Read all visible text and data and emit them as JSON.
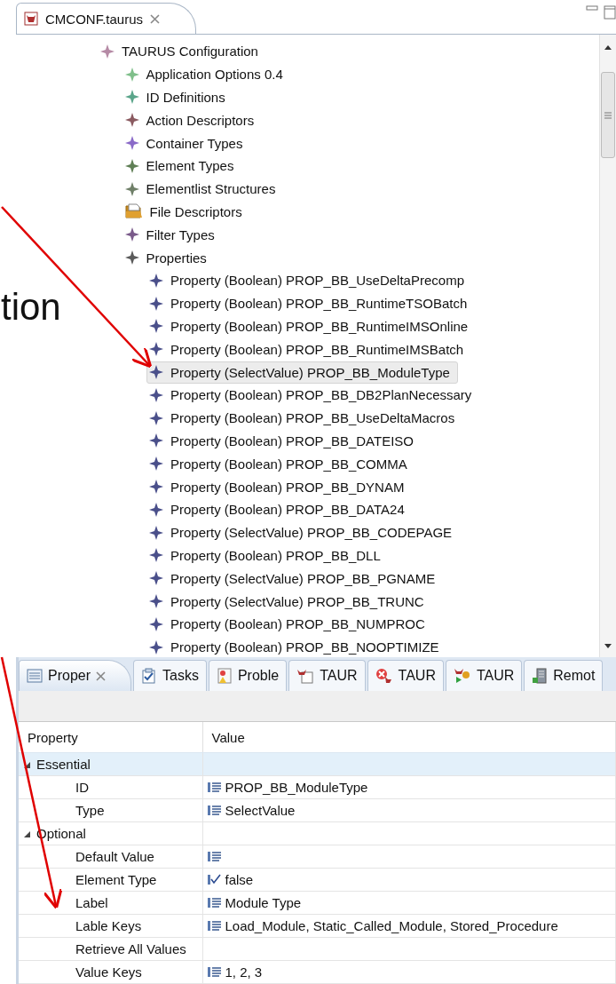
{
  "editor_tab": {
    "title": "CMCONF.taurus",
    "selected": true
  },
  "annotation": {
    "text": "tion"
  },
  "tree": [
    {
      "label": "TAURUS Configuration",
      "kind": "diamond",
      "color": "#b58aa5",
      "selected": false,
      "children": [
        {
          "label": "Application Options 0.4",
          "kind": "diamond",
          "color": "#7fbf8a",
          "selected": false
        },
        {
          "label": "ID Definitions",
          "kind": "diamond",
          "color": "#5aa58a",
          "selected": false
        },
        {
          "label": "Action Descriptors",
          "kind": "diamond",
          "color": "#8a5a60",
          "selected": false
        },
        {
          "label": "Container Types",
          "kind": "diamond",
          "color": "#8a6ac8",
          "selected": false
        },
        {
          "label": "Element Types",
          "kind": "diamond",
          "color": "#5f7f55",
          "selected": false
        },
        {
          "label": "Elementlist Structures",
          "kind": "diamond",
          "color": "#6f7f68",
          "selected": false
        },
        {
          "label": "File Descriptors",
          "kind": "folder",
          "color": "#e0a030",
          "selected": false
        },
        {
          "label": "Filter Types",
          "kind": "diamond",
          "color": "#7a5a8a",
          "selected": false
        },
        {
          "label": "Properties",
          "kind": "diamond",
          "color": "#5a5a5a",
          "selected": false,
          "children": [
            {
              "label": "Property (Boolean) PROP_BB_UseDeltaPrecomp",
              "kind": "diamond",
              "color": "#4a4f8a",
              "selected": false
            },
            {
              "label": "Property (Boolean) PROP_BB_RuntimeTSOBatch",
              "kind": "diamond",
              "color": "#4a4f8a",
              "selected": false
            },
            {
              "label": "Property (Boolean) PROP_BB_RuntimeIMSOnline",
              "kind": "diamond",
              "color": "#4a4f8a",
              "selected": false
            },
            {
              "label": "Property (Boolean) PROP_BB_RuntimeIMSBatch",
              "kind": "diamond",
              "color": "#4a4f8a",
              "selected": false
            },
            {
              "label": "Property (SelectValue) PROP_BB_ModuleType",
              "kind": "diamond",
              "color": "#4a4f8a",
              "selected": true
            },
            {
              "label": "Property (Boolean) PROP_BB_DB2PlanNecessary",
              "kind": "diamond",
              "color": "#4a4f8a",
              "selected": false
            },
            {
              "label": "Property (Boolean) PROP_BB_UseDeltaMacros",
              "kind": "diamond",
              "color": "#4a4f8a",
              "selected": false
            },
            {
              "label": "Property (Boolean) PROP_BB_DATEISO",
              "kind": "diamond",
              "color": "#4a4f8a",
              "selected": false
            },
            {
              "label": "Property (Boolean) PROP_BB_COMMA",
              "kind": "diamond",
              "color": "#4a4f8a",
              "selected": false
            },
            {
              "label": "Property (Boolean) PROP_BB_DYNAM",
              "kind": "diamond",
              "color": "#4a4f8a",
              "selected": false
            },
            {
              "label": "Property (Boolean) PROP_BB_DATA24",
              "kind": "diamond",
              "color": "#4a4f8a",
              "selected": false
            },
            {
              "label": "Property (SelectValue) PROP_BB_CODEPAGE",
              "kind": "diamond",
              "color": "#4a4f8a",
              "selected": false
            },
            {
              "label": "Property (Boolean) PROP_BB_DLL",
              "kind": "diamond",
              "color": "#4a4f8a",
              "selected": false
            },
            {
              "label": "Property (SelectValue) PROP_BB_PGNAME",
              "kind": "diamond",
              "color": "#4a4f8a",
              "selected": false
            },
            {
              "label": "Property (SelectValue) PROP_BB_TRUNC",
              "kind": "diamond",
              "color": "#4a4f8a",
              "selected": false
            },
            {
              "label": "Property (Boolean) PROP_BB_NUMPROC",
              "kind": "diamond",
              "color": "#4a4f8a",
              "selected": false
            },
            {
              "label": "Property (Boolean) PROP_BB_NOOPTIMIZE",
              "kind": "diamond",
              "color": "#4a4f8a",
              "selected": false
            }
          ]
        }
      ]
    }
  ],
  "view_tabs": [
    {
      "label": "Proper",
      "kind": "list",
      "selected": true
    },
    {
      "label": "Tasks",
      "kind": "tasks",
      "selected": false
    },
    {
      "label": "Proble",
      "kind": "problems",
      "selected": false
    },
    {
      "label": "TAUR",
      "kind": "document",
      "selected": false
    },
    {
      "label": "TAUR",
      "kind": "error",
      "selected": false
    },
    {
      "label": "TAUR",
      "kind": "run",
      "selected": false
    },
    {
      "label": "Remot",
      "kind": "server",
      "selected": false
    }
  ],
  "properties": {
    "columns": [
      "Property",
      "Value"
    ],
    "categories": [
      {
        "name": "Essential",
        "expanded": true,
        "selected": true,
        "rows": [
          {
            "property": "ID",
            "kind": "text",
            "value": "PROP_BB_ModuleType"
          },
          {
            "property": "Type",
            "kind": "text",
            "value": "SelectValue"
          }
        ]
      },
      {
        "name": "Optional",
        "expanded": true,
        "selected": false,
        "rows": [
          {
            "property": "Default Value",
            "kind": "text"
          },
          {
            "property": "Element Type",
            "kind": "boolean",
            "value": "false"
          },
          {
            "property": "Label",
            "kind": "text",
            "value": "Module Type"
          },
          {
            "property": "Lable Keys",
            "kind": "text",
            "value": "Load_Module, Static_Called_Module, Stored_Procedure"
          },
          {
            "property": "Retrieve All Values",
            "kind": "empty"
          },
          {
            "property": "Value Keys",
            "kind": "text",
            "value": "1, 2, 3"
          }
        ]
      }
    ]
  }
}
